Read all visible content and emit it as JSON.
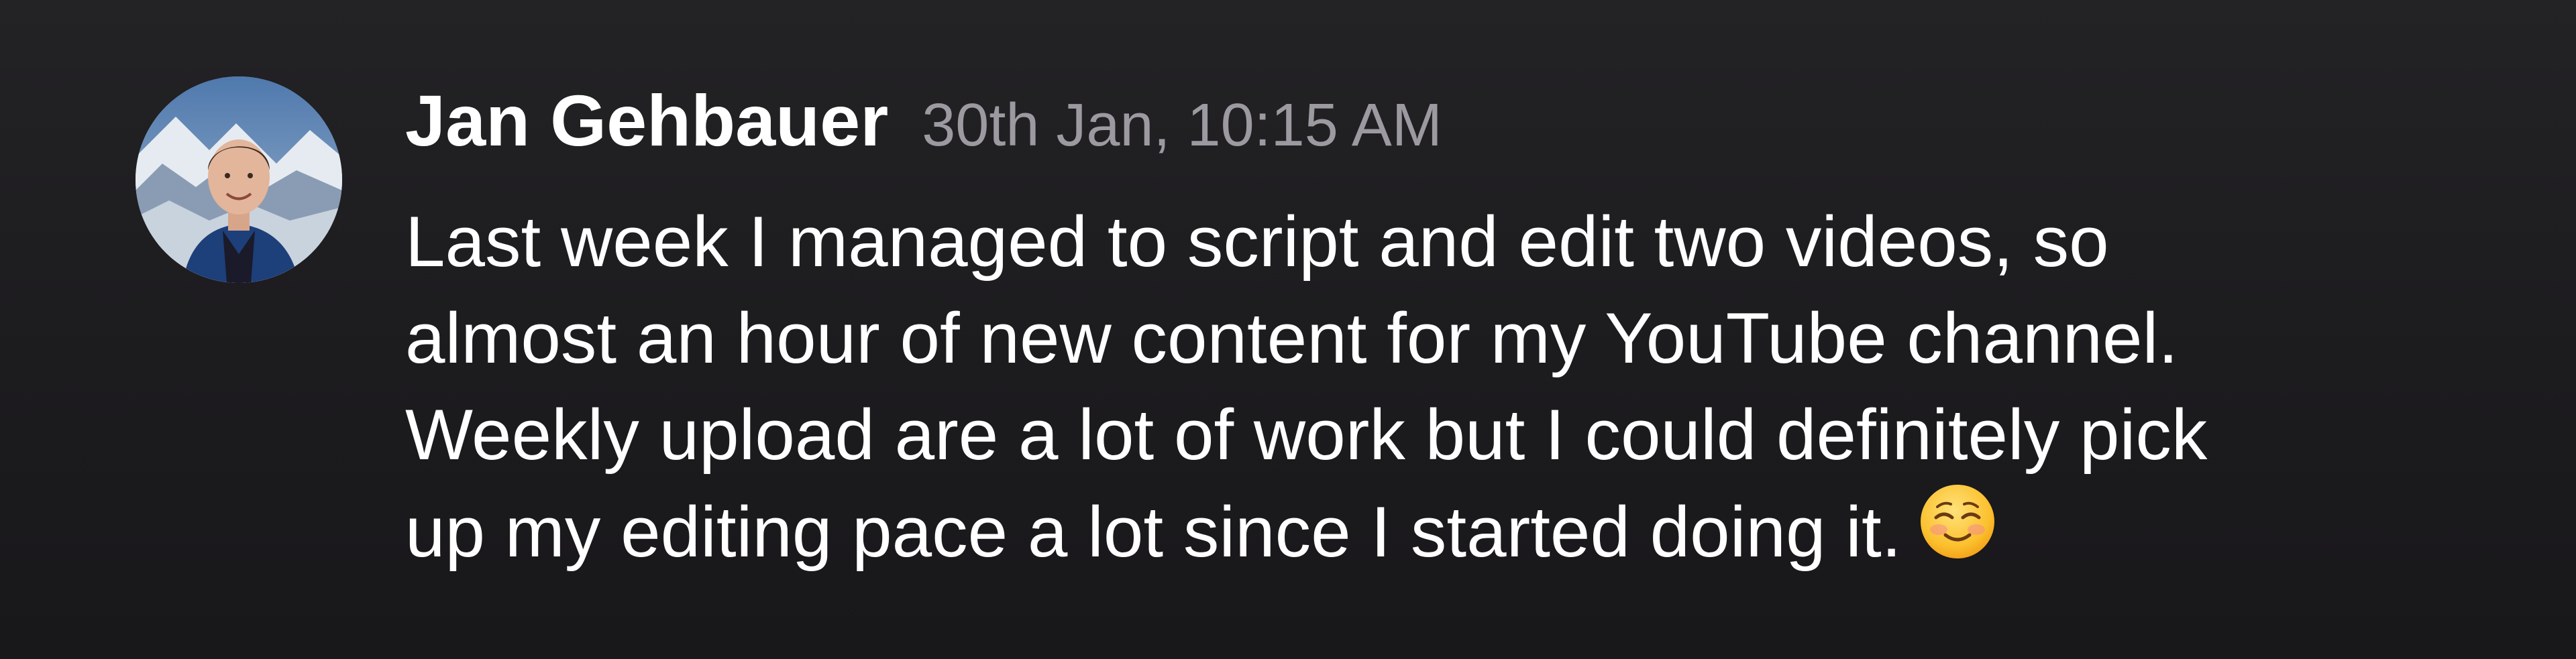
{
  "message": {
    "author": "Jan Gehbauer",
    "timestamp": "30th Jan, 10:15 AM",
    "lines": [
      "Last week I managed to script and edit two videos, so",
      "almost an hour of new content for my YouTube channel.",
      "Weekly upload are a lot of work but I could definitely pick",
      "up my editing pace a lot since I started doing it."
    ],
    "emoji_icon": "smiling-face-icon",
    "avatar_icon": "user-avatar-photo"
  },
  "colors": {
    "background": "#1c1b1e",
    "text": "#ffffff",
    "timestamp": "#9c9aa0"
  }
}
